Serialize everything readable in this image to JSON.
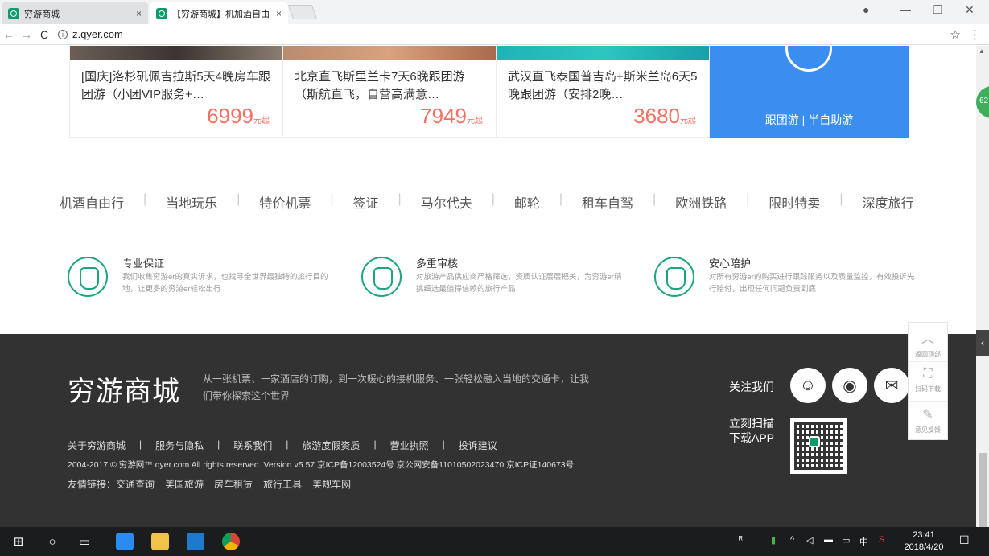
{
  "browser": {
    "tabs": [
      {
        "title": "穷游商城",
        "close": "×"
      },
      {
        "title": "【穷游商城】机加酒自由",
        "close": "×"
      }
    ],
    "url": "z.qyer.com",
    "url_icon": "i",
    "back_icon": "←",
    "forward_icon": "→",
    "reload_icon": "C",
    "star_icon": "☆",
    "menu_icon": "⋮",
    "account_icon": "●",
    "minimize_icon": "—",
    "maximize_icon": "❐",
    "close_icon": "✕"
  },
  "products": [
    {
      "title": "[国庆]洛杉矶佩吉拉斯5天4晚房车跟团游（小团VIP服务+…",
      "price": "6999",
      "unit": "元起"
    },
    {
      "title": "北京直飞斯里兰卡7天6晚跟团游（斯航直飞，自营高满意…",
      "price": "7949",
      "unit": "元起"
    },
    {
      "title": "武汉直飞泰国普吉岛+斯米兰岛6天5晚跟团游（安排2晚…",
      "price": "3680",
      "unit": "元起"
    }
  ],
  "promo": {
    "label": "跟团游 | 半自助游"
  },
  "badge": "62",
  "categories": [
    "机酒自由行",
    "当地玩乐",
    "特价机票",
    "签证",
    "马尔代夫",
    "邮轮",
    "租车自驾",
    "欧洲铁路",
    "限时特卖",
    "深度旅行"
  ],
  "category_sep": "|",
  "features": [
    {
      "title": "专业保证",
      "desc": "我们收集穷游er的真实诉求，也找寻全世界最独特的旅行目的地，让更多的穷游er轻松出行"
    },
    {
      "title": "多重审核",
      "desc": "对旅游产品供应商严格筛选，资质认证层层把关，为穷游er精挑细选最值得信赖的旅行产品"
    },
    {
      "title": "安心陪护",
      "desc": "对所有穷游er的购买进行跟踪服务以及质量监控，有效投诉先行赔付，出现任何问题负责到底"
    }
  ],
  "footer": {
    "brand": "穷游商城",
    "slogan": "从一张机票、一家酒店的订购，到一次暖心的接机服务、一张轻松融入当地的交通卡，让我们带你探索这个世界",
    "follow": "关注我们",
    "download_line1": "立刻扫描",
    "download_line2": "下载APP",
    "links": [
      "关于穷游商城",
      "服务与隐私",
      "联系我们",
      "旅游度假资质",
      "营业执照",
      "投诉建议"
    ],
    "link_sep": "|",
    "copyright": "2004-2017 © 穷游网™ qyer.com All rights reserved. Version v5.57 京ICP备12003524号 京公网安备11010502023470 京ICP证140673号",
    "friends_label": "友情链接：",
    "friends": [
      "交通查询",
      "美国旅游",
      "房车租赁",
      "旅行工具",
      "美规车网"
    ]
  },
  "sidetool": [
    {
      "icon": "︿",
      "label": "返回顶部"
    },
    {
      "icon": "⛶",
      "label": "扫码下载"
    },
    {
      "icon": "✎",
      "label": "意见反馈"
    }
  ],
  "sidetab": "‹",
  "taskbar": {
    "time": "23:41",
    "date": "2018/4/20",
    "ime": "中"
  },
  "colors": {
    "accent": "#19a680",
    "price": "#f86e62",
    "promo": "#3a8ef0",
    "footer": "#323232"
  }
}
